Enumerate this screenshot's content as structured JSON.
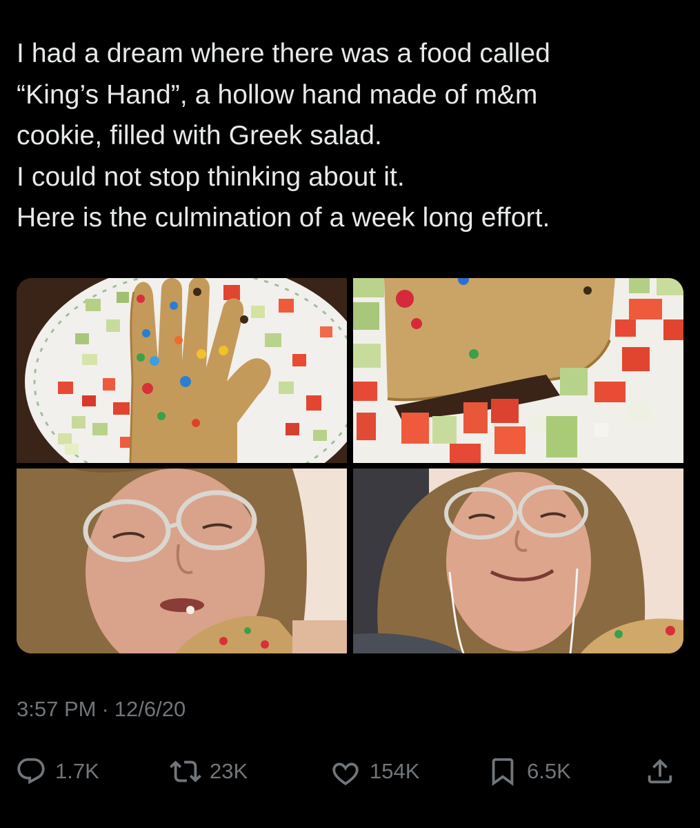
{
  "tweet": {
    "text_lines": [
      "I had a dream where there was a food called",
      "“King’s Hand”, a hollow hand made of m&m",
      "cookie, filled with Greek salad.",
      "I could not stop thinking about it.",
      "Here is the culmination of a week long effort."
    ],
    "time": "3:57 PM",
    "separator": "·",
    "date": "12/6/20"
  },
  "actions": {
    "replies": "1.7K",
    "reposts": "23K",
    "likes": "154K",
    "bookmarks": "6.5K"
  },
  "icons": {
    "reply": "reply-icon",
    "repost": "repost-icon",
    "like": "heart-icon",
    "bookmark": "bookmark-icon",
    "share": "share-icon"
  },
  "colors": {
    "background": "#000000",
    "text": "#e7e9ea",
    "secondary": "#71767b"
  }
}
